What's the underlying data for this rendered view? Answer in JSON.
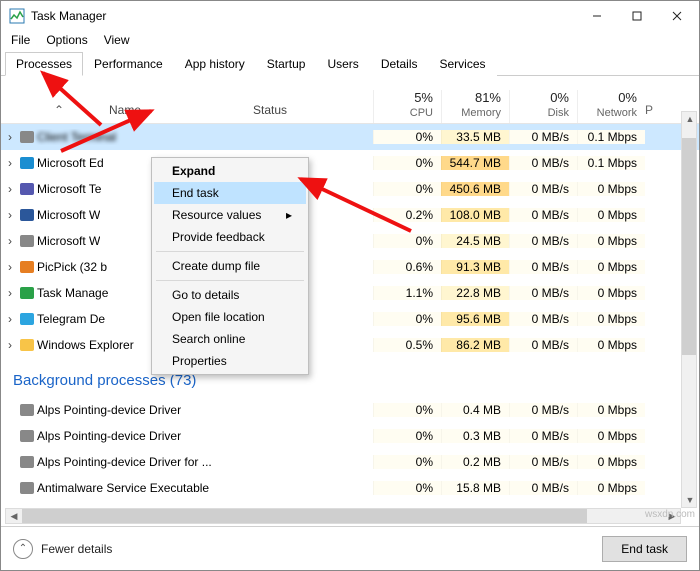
{
  "window": {
    "title": "Task Manager"
  },
  "menubar": {
    "file": "File",
    "options": "Options",
    "view": "View"
  },
  "tabs": {
    "processes": "Processes",
    "performance": "Performance",
    "app_history": "App history",
    "startup": "Startup",
    "users": "Users",
    "details": "Details",
    "services": "Services"
  },
  "columns": {
    "name": "Name",
    "status": "Status",
    "cpu_pct": "5%",
    "cpu": "CPU",
    "mem_pct": "81%",
    "mem": "Memory",
    "disk_pct": "0%",
    "disk": "Disk",
    "net_pct": "0%",
    "net": "Network",
    "p": "P"
  },
  "rows": [
    {
      "name": "Client Terminal",
      "cpu": "0%",
      "mem": "33.5 MB",
      "disk": "0 MB/s",
      "net": "0.1 Mbps",
      "selected": true,
      "icon": "app-generic"
    },
    {
      "name": "Microsoft Ed",
      "cpu": "0%",
      "mem": "544.7 MB",
      "disk": "0 MB/s",
      "net": "0.1 Mbps",
      "icon": "edge"
    },
    {
      "name": "Microsoft Te",
      "cpu": "0%",
      "mem": "450.6 MB",
      "disk": "0 MB/s",
      "net": "0 Mbps",
      "icon": "teams"
    },
    {
      "name": "Microsoft W",
      "cpu": "0.2%",
      "mem": "108.0 MB",
      "disk": "0 MB/s",
      "net": "0 Mbps",
      "icon": "word"
    },
    {
      "name": "Microsoft W",
      "cpu": "0%",
      "mem": "24.5 MB",
      "disk": "0 MB/s",
      "net": "0 Mbps",
      "icon": "app-generic"
    },
    {
      "name": "PicPick (32 b",
      "cpu": "0.6%",
      "mem": "91.3 MB",
      "disk": "0 MB/s",
      "net": "0 Mbps",
      "icon": "picpick"
    },
    {
      "name": "Task Manage",
      "cpu": "1.1%",
      "mem": "22.8 MB",
      "disk": "0 MB/s",
      "net": "0 Mbps",
      "icon": "taskmgr"
    },
    {
      "name": "Telegram De",
      "cpu": "0%",
      "mem": "95.6 MB",
      "disk": "0 MB/s",
      "net": "0 Mbps",
      "icon": "telegram"
    },
    {
      "name": "Windows Explorer",
      "cpu": "0.5%",
      "mem": "86.2 MB",
      "disk": "0 MB/s",
      "net": "0 Mbps",
      "icon": "explorer"
    }
  ],
  "group_bg": "Background processes (73)",
  "bg_rows": [
    {
      "name": "Alps Pointing-device Driver",
      "cpu": "0%",
      "mem": "0.4 MB",
      "disk": "0 MB/s",
      "net": "0 Mbps"
    },
    {
      "name": "Alps Pointing-device Driver",
      "cpu": "0%",
      "mem": "0.3 MB",
      "disk": "0 MB/s",
      "net": "0 Mbps"
    },
    {
      "name": "Alps Pointing-device Driver for ...",
      "cpu": "0%",
      "mem": "0.2 MB",
      "disk": "0 MB/s",
      "net": "0 Mbps"
    },
    {
      "name": "Antimalware Service Executable",
      "cpu": "0%",
      "mem": "15.8 MB",
      "disk": "0 MB/s",
      "net": "0 Mbps"
    }
  ],
  "context_menu": {
    "expand": "Expand",
    "end_task": "End task",
    "resource_values": "Resource values",
    "provide_feedback": "Provide feedback",
    "create_dump": "Create dump file",
    "go_to_details": "Go to details",
    "open_file_loc": "Open file location",
    "search_online": "Search online",
    "properties": "Properties"
  },
  "footer": {
    "fewer": "Fewer details",
    "end_task": "End task"
  },
  "watermark": "wsxdn.com"
}
